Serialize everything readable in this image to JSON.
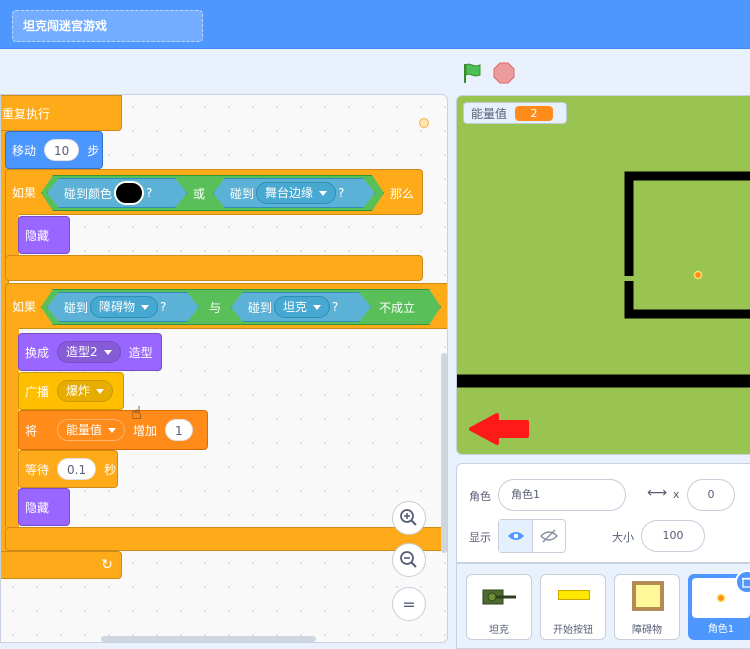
{
  "project_title": "坦克闯迷宫游戏",
  "script": {
    "repeat_label": "重复执行",
    "move": {
      "label": "移动",
      "steps": "10",
      "unit": "步"
    },
    "if1": {
      "if_label": "如果",
      "touch_color_label": "碰到颜色",
      "q1": "?",
      "or_label": "或",
      "touch_label": "碰到",
      "target": "舞台边缘",
      "q2": "?",
      "then_label": "那么"
    },
    "hide1": "隐藏",
    "if2": {
      "if_label": "如果",
      "touch_label_1": "碰到",
      "target_1": "障碍物",
      "q1": "?",
      "and_label": "与",
      "touch_label_2": "碰到",
      "target_2": "坦克",
      "q2": "?",
      "not_label": "不成立"
    },
    "switch_costume": {
      "label": "换成",
      "costume": "造型2",
      "suffix": "造型"
    },
    "broadcast": {
      "label": "广播",
      "message": "爆炸"
    },
    "change_var": {
      "label": "将",
      "variable": "能量值",
      "by_label": "增加",
      "amount": "1"
    },
    "wait": {
      "label": "等待",
      "seconds": "0.1",
      "unit": "秒"
    },
    "hide2": "隐藏",
    "loop_arrow": "↻"
  },
  "zoom": {
    "in": "+",
    "out": "−",
    "reset": "="
  },
  "stage": {
    "monitor_label": "能量值",
    "monitor_value": "2"
  },
  "sprite_info": {
    "sprite_label": "角色",
    "sprite_name": "角色1",
    "x_label": "x",
    "x_value": "0",
    "show_label": "显示",
    "size_label": "大小",
    "size_value": "100"
  },
  "sprites": [
    {
      "name": "坦克",
      "icon": "tank-icon"
    },
    {
      "name": "开始按钮",
      "icon": "start-button-icon"
    },
    {
      "name": "障碍物",
      "icon": "obstacle-icon"
    },
    {
      "name": "角色1",
      "icon": "dot-icon"
    }
  ],
  "colors": {
    "control": "#ffab19",
    "motion": "#4c97ff",
    "looks": "#9966ff",
    "events": "#ffbf00",
    "variables": "#ff8c1a",
    "operators": "#59c059",
    "sensing": "#5cb1d6",
    "stage_bg": "#9ac451",
    "arrow": "#ff1a1a"
  }
}
